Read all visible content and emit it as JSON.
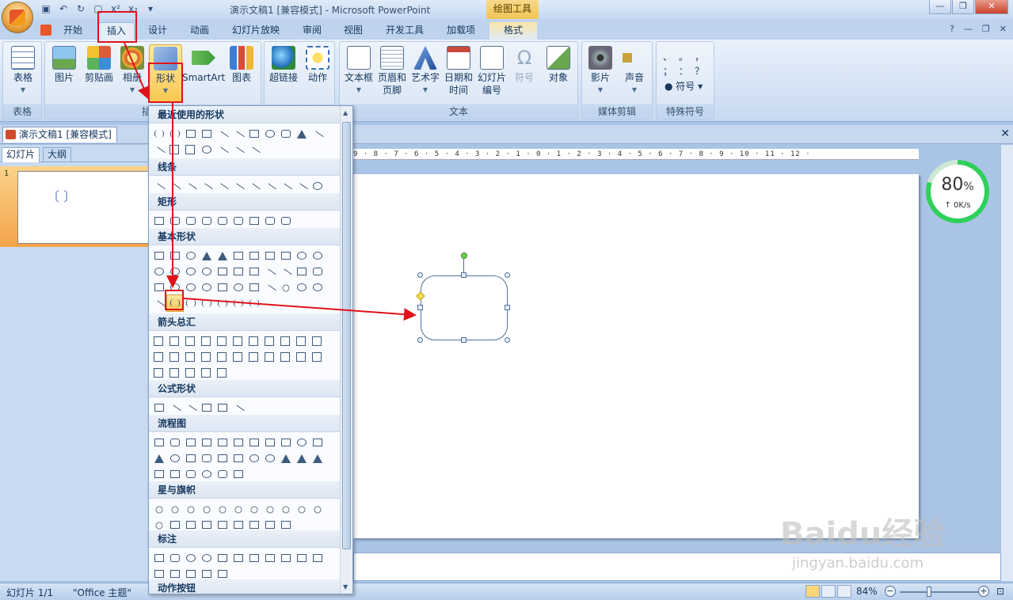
{
  "window": {
    "title": "演示文稿1 [兼容模式] - Microsoft PowerPoint",
    "context_tools": "绘图工具"
  },
  "tabs": [
    {
      "label": "开始"
    },
    {
      "label": "插入"
    },
    {
      "label": "设计"
    },
    {
      "label": "动画"
    },
    {
      "label": "幻灯片放映"
    },
    {
      "label": "审阅"
    },
    {
      "label": "视图"
    },
    {
      "label": "开发工具"
    },
    {
      "label": "加载项"
    },
    {
      "label": "格式"
    }
  ],
  "ribbon": {
    "groups": {
      "table": "表格",
      "illustrations": "插",
      "text": "文本",
      "media": "媒体剪辑",
      "special": "特殊符号"
    },
    "buttons": {
      "table": "表格",
      "picture": "图片",
      "clipart": "剪贴画",
      "album": "相册",
      "shapes": "形状",
      "smartart": "SmartArt",
      "chart": "图表",
      "hyperlink": "超链接",
      "action": "动作",
      "textbox": "文本框",
      "header_footer_1": "页眉和",
      "header_footer_2": "页脚",
      "wordart": "艺术字",
      "datetime_1": "日期和",
      "datetime_2": "时间",
      "slidenum_1": "幻灯片",
      "slidenum_2": "编号",
      "symbol": "符号",
      "object": "对象",
      "movie": "影片",
      "sound": "声音",
      "special_symbol": "符号"
    },
    "special_symbols": [
      "、",
      "。",
      "，",
      "；",
      "：",
      "？"
    ]
  },
  "document_tab": "演示文稿1 [兼容模式]",
  "left_pane": {
    "tab_slides": "幻灯片",
    "tab_outline": "大纲",
    "slide_number": "1",
    "thumb_content": "〔 〕"
  },
  "ruler_text": "9 · 8 · 7 · 6 · 5 · 4 · 3 · 2 · 1 · 0 · 1 · 2 · 3 · 4 · 5 · 6 · 7 · 8 · 9 · 10 · 11 · 12 ·",
  "gallery": {
    "sections": [
      {
        "title": "最近使用的形状"
      },
      {
        "title": "线条"
      },
      {
        "title": "矩形"
      },
      {
        "title": "基本形状"
      },
      {
        "title": "箭头总汇"
      },
      {
        "title": "公式形状"
      },
      {
        "title": "流程图"
      },
      {
        "title": "星与旗帜"
      },
      {
        "title": "标注"
      },
      {
        "title": "动作按钮"
      }
    ]
  },
  "speed_widget": {
    "percent": "80",
    "percent_sign": "%",
    "rate": "↑ 0K/s",
    "fill_fraction": 0.8
  },
  "statusbar": {
    "slide": "幻灯片 1/1",
    "theme": "\"Office 主题\"",
    "zoom": "84%"
  },
  "watermark": {
    "brand": "Baidu经验",
    "url": "jingyan.baidu.com"
  },
  "colors": {
    "annotation_red": "#e0131b",
    "selection_highlight": "#f7c653"
  }
}
